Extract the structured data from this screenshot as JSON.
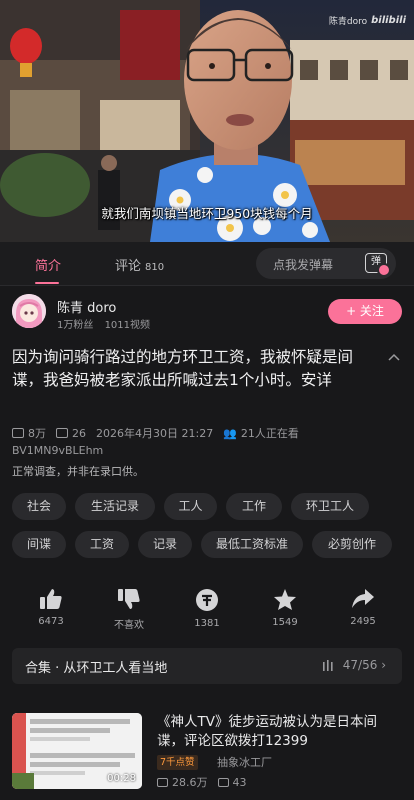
{
  "video": {
    "watermark_user": "陈青doro",
    "watermark_brand": "bilibili",
    "subtitle": "就我们南坝镇当地环卫950块钱每个月"
  },
  "tabs": [
    {
      "label": "简介"
    },
    {
      "label": "评论",
      "count": "810"
    }
  ],
  "danmaku": {
    "placeholder": "点我发弹幕",
    "button_label": "弹"
  },
  "uploader": {
    "name": "陈青 doro",
    "followers": "1万粉丝",
    "videos": "1011视频",
    "follow_label": "+ 关注"
  },
  "video_info": {
    "title": "因为询问骑行路过的地方环卫工资，我被怀疑是间谍，我爸妈被老家派出所喊过去1个小时。安详",
    "views": "8万",
    "danmaku_count": "26",
    "date": "2026年4月30日 21:27",
    "watching": "21人正在看",
    "bvid": "BV1MN9vBLEhm",
    "description": "正常调查，并非在录口供。"
  },
  "tags": [
    "社会",
    "生活记录",
    "工人",
    "工作",
    "环卫工人",
    "间谍",
    "工资",
    "记录",
    "最低工资标准",
    "必剪创作"
  ],
  "actions": [
    {
      "name": "like",
      "count": "6473"
    },
    {
      "name": "dislike",
      "count": "不喜欢"
    },
    {
      "name": "coin",
      "count": "1381"
    },
    {
      "name": "favorite",
      "count": "1549"
    },
    {
      "name": "share",
      "count": "2495"
    }
  ],
  "collection": {
    "label": "合集 · 从环卫工人看当地",
    "progress": "47/56"
  },
  "related": {
    "title": "《神人TV》徒步运动被认为是日本间谍，评论区欲拨打12399",
    "badge": "7千点赞",
    "author": "抽象冰工厂",
    "views": "28.6万",
    "comments": "43",
    "duration": "00:28"
  },
  "colors": {
    "accent": "#fb7299",
    "background": "#18181a"
  }
}
